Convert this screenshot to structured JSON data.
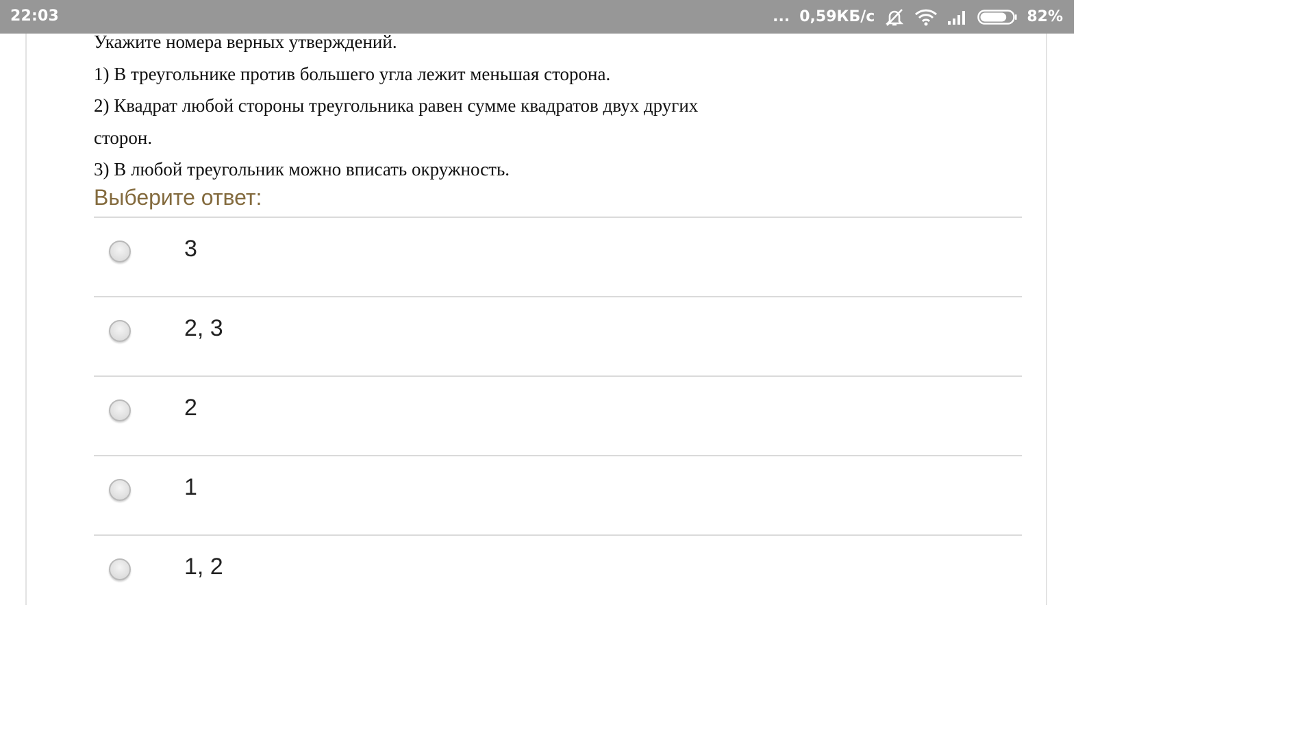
{
  "status_bar": {
    "time": "22:03",
    "dots": "...",
    "speed": "0,59КБ/с",
    "battery_percent": "82%",
    "battery_level": 0.82,
    "icons": [
      "more-dots-icon",
      "notifications-off-icon",
      "wifi-icon",
      "cellular-signal-icon",
      "battery-icon"
    ]
  },
  "question": {
    "lines": [
      "Укажите номера верных утверждений.",
      "1) В треугольнике против большего угла лежит меньшая сторона.",
      "2) Квадрат любой стороны треугольника равен сумме квадратов двух других",
      "сторон.",
      "3) В любой треугольник можно вписать окружность."
    ]
  },
  "prompt": "Выберите ответ:",
  "answers": [
    {
      "label": "3",
      "selected": false
    },
    {
      "label": "2, 3",
      "selected": false
    },
    {
      "label": "2",
      "selected": false
    },
    {
      "label": "1",
      "selected": false
    },
    {
      "label": "1, 2",
      "selected": false
    }
  ],
  "colors": {
    "status_bar_bg": "#979797",
    "prompt_text": "#836a3d",
    "divider": "#dadada"
  }
}
